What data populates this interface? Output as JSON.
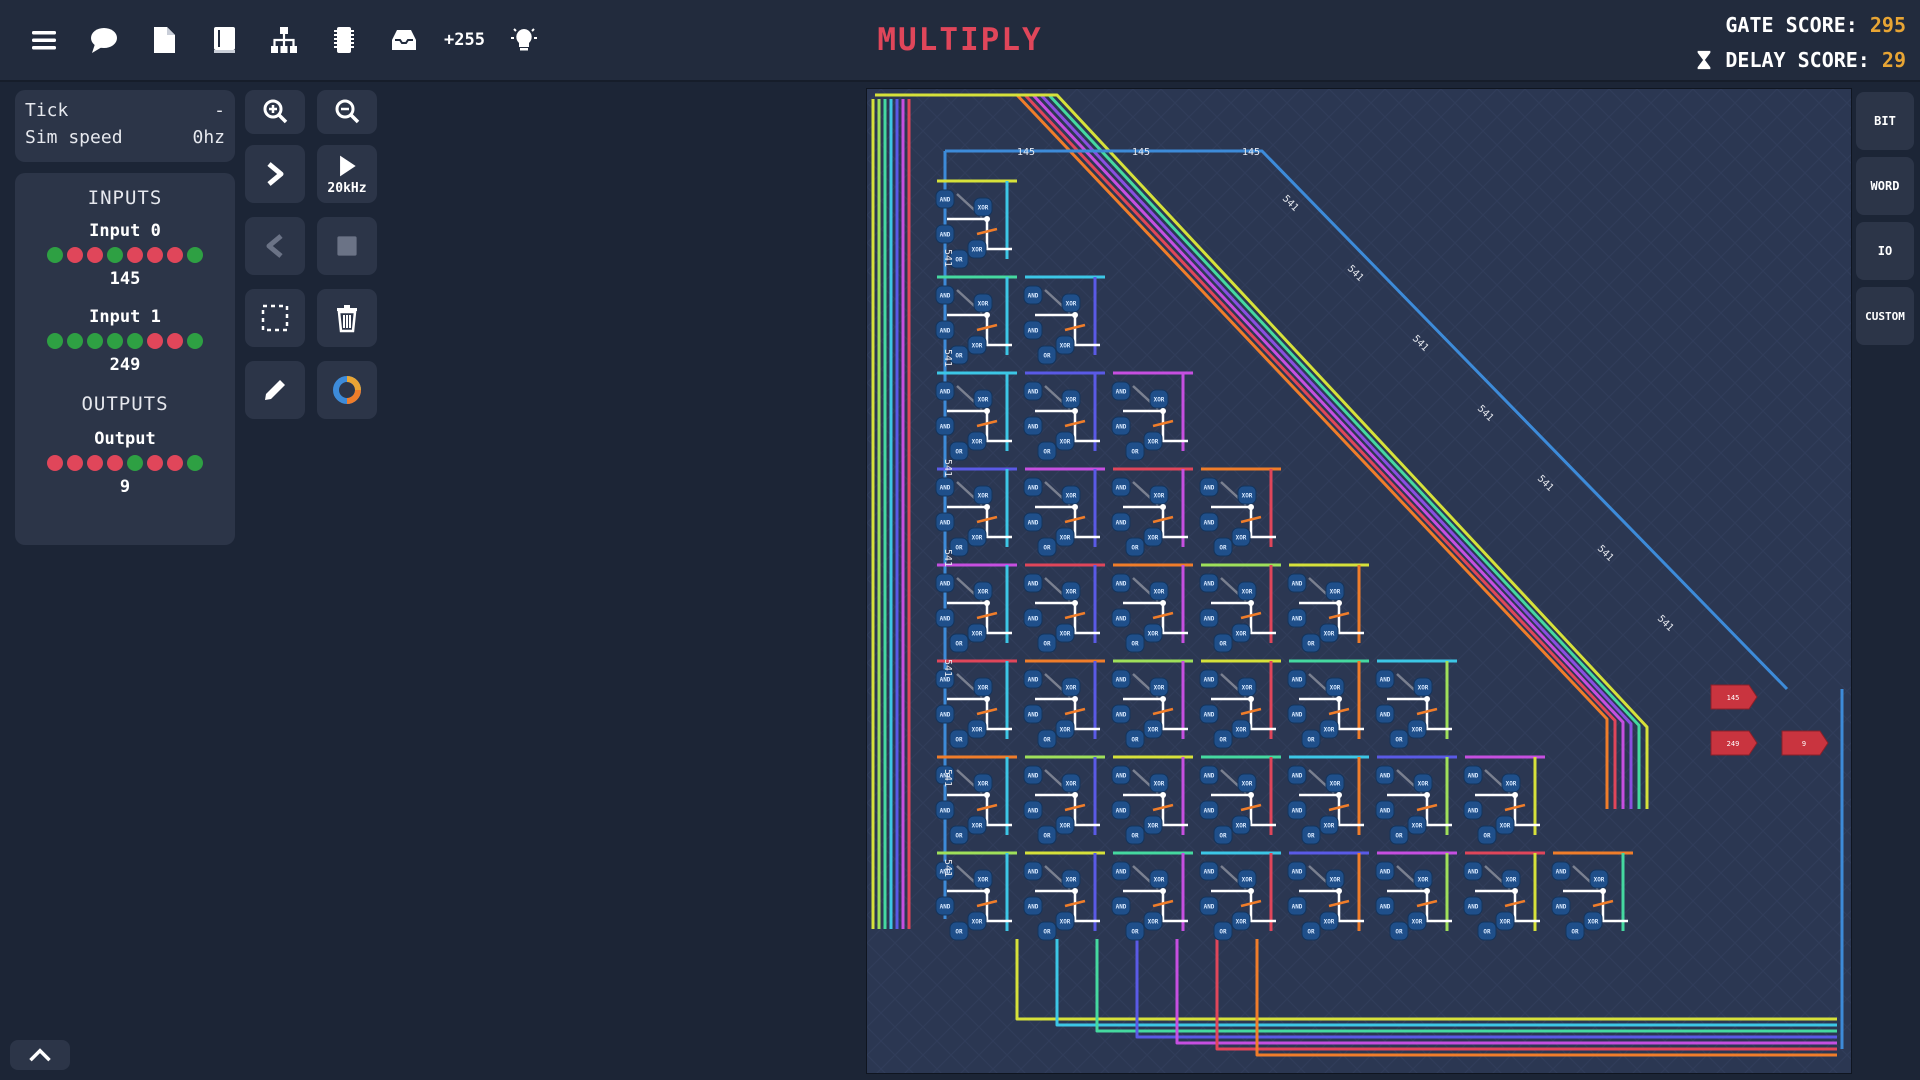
{
  "toolbar": {
    "icons": [
      "menu-icon",
      "chat-icon",
      "file-icon",
      "book-icon",
      "hierarchy-icon",
      "tape-icon",
      "inbox-icon",
      "lightbulb-icon"
    ],
    "counter_label": "+255"
  },
  "title": "MULTIPLY",
  "scores": {
    "gate_label": "GATE SCORE:",
    "gate_value": "295",
    "delay_label": "DELAY SCORE:",
    "delay_value": "29"
  },
  "sim": {
    "tick_label": "Tick",
    "tick_value": "-",
    "speed_label": "Sim speed",
    "speed_value": "0hz"
  },
  "io": {
    "inputs_title": "INPUTS",
    "outputs_title": "OUTPUTS",
    "input0": {
      "label": "Input 0",
      "value": "145",
      "bits": [
        1,
        0,
        0,
        1,
        0,
        0,
        0,
        1
      ]
    },
    "input1": {
      "label": "Input 1",
      "value": "249",
      "bits": [
        1,
        1,
        1,
        1,
        1,
        0,
        0,
        1
      ]
    },
    "output": {
      "label": "Output",
      "value": "9",
      "bits": [
        0,
        0,
        0,
        0,
        1,
        0,
        0,
        1
      ]
    }
  },
  "controls": {
    "play_speed_label": "20kHz"
  },
  "side_tabs": [
    "BIT",
    "WORD",
    "IO",
    "CUSTOM"
  ],
  "colors": {
    "bit_on": "#2ea043",
    "bit_off": "#e0465a",
    "accent": "#e8a534",
    "title": "#e0465a",
    "canvas_bg": "#2a3650"
  },
  "circuit": {
    "wire_labels": {
      "bus_145": "145",
      "bus_541": "541"
    },
    "component_labels": {
      "and": "AND",
      "xor": "XOR",
      "or": "OR"
    },
    "io_nodes": [
      "145",
      "249",
      "9"
    ]
  }
}
